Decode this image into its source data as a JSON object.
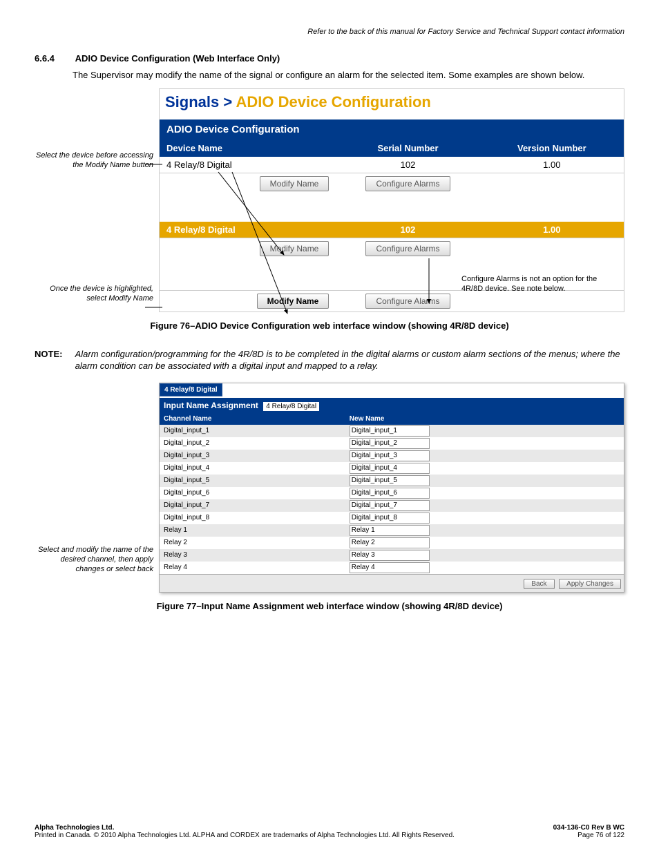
{
  "header_note": "Refer to the back of this manual for Factory Service and Technical Support contact information",
  "section": {
    "num": "6.6.4",
    "title": "ADIO Device Configuration (Web Interface Only)"
  },
  "intro": "The Supervisor may modify the name of the signal or configure an alarm for the selected item. Some examples are shown below.",
  "annot1": "Select the device before accessing the Modify Name button",
  "breadcrumb": {
    "a": "Signals >",
    "b": "ADIO Device Configuration"
  },
  "panel_title": "ADIO Device Configuration",
  "cols": {
    "c1": "Device Name",
    "c2": "Serial Number",
    "c3": "Version Number"
  },
  "row": {
    "name": "4 Relay/8 Digital",
    "serial": "102",
    "ver": "1.00"
  },
  "btns": {
    "modify": "Modify Name",
    "config": "Configure Alarms"
  },
  "side_note_r": "Configure Alarms is not an option for the 4R/8D device. See note below.",
  "annot2": "Once the device is highlighted, select Modify Name",
  "fig76": "Figure 76–ADIO Device Configuration web interface window (showing 4R/8D device)",
  "note_label": "NOTE:",
  "note_text": "Alarm configuration/programming for the 4R/8D is to be completed in the digital alarms or custom alarm sections of the menus; where the alarm condition can be associated with a digital input and mapped to a relay.",
  "annot3": "Select and modify the name of the desired channel, then apply changes or select back",
  "tab": "4 Relay/8 Digital",
  "assign_title": "Input Name Assignment",
  "assign_dev": "4 Relay/8 Digital",
  "inp_cols": {
    "c1": "Channel Name",
    "c2": "New Name"
  },
  "inputs": [
    {
      "ch": "Digital_input_1",
      "nn": "Digital_input_1"
    },
    {
      "ch": "Digital_input_2",
      "nn": "Digital_input_2"
    },
    {
      "ch": "Digital_input_3",
      "nn": "Digital_input_3"
    },
    {
      "ch": "Digital_input_4",
      "nn": "Digital_input_4"
    },
    {
      "ch": "Digital_input_5",
      "nn": "Digital_input_5"
    },
    {
      "ch": "Digital_input_6",
      "nn": "Digital_input_6"
    },
    {
      "ch": "Digital_input_7",
      "nn": "Digital_input_7"
    },
    {
      "ch": "Digital_input_8",
      "nn": "Digital_input_8"
    },
    {
      "ch": "Relay 1",
      "nn": "Relay 1"
    },
    {
      "ch": "Relay 2",
      "nn": "Relay 2"
    },
    {
      "ch": "Relay 3",
      "nn": "Relay 3"
    },
    {
      "ch": "Relay 4",
      "nn": "Relay 4"
    }
  ],
  "btn_back": "Back",
  "btn_apply": "Apply Changes",
  "fig77": "Figure 77–Input Name Assignment web interface window (showing 4R/8D device)",
  "footer": {
    "company": "Alpha Technologies Ltd.",
    "copy": "Printed in Canada.  © 2010 Alpha Technologies Ltd.  ALPHA and CORDEX are trademarks of Alpha Technologies Ltd.  All Rights Reserved.",
    "doc": "034-136-C0  Rev B  WC",
    "page": "Page 76 of 122"
  }
}
